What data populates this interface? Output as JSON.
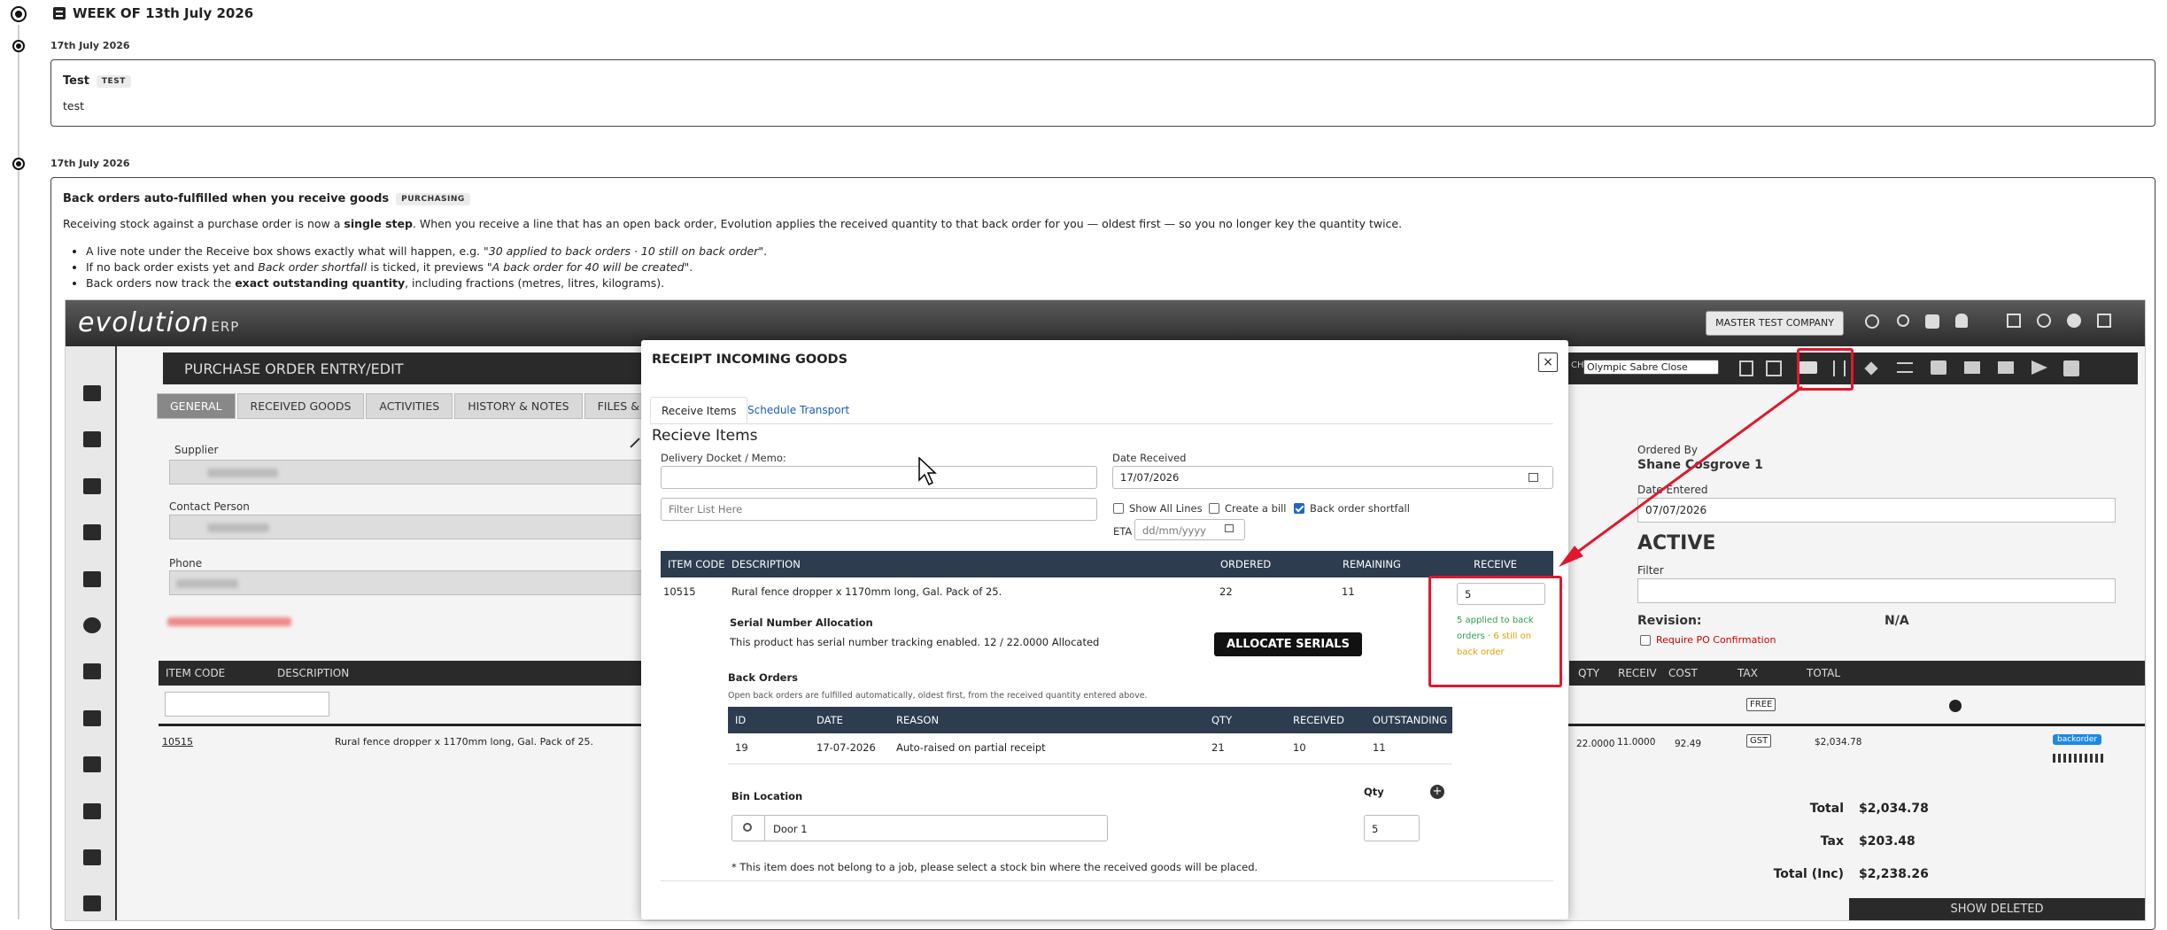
{
  "timeline": {
    "week": "WEEK OF 13th July 2026",
    "entries": [
      {
        "date": "17th July 2026",
        "title": "Test",
        "badge": "TEST",
        "body": "test"
      },
      {
        "date": "17th July 2026",
        "title": "Back orders auto-fulfilled when you receive goods",
        "badge": "PURCHASING",
        "intro_1": "Receiving stock against a purchase order is now a ",
        "intro_bold": "single step",
        "intro_2": ". When you receive a line that has an open back order, Evolution applies the received quantity to that back order for you — oldest first — so you no longer key the quantity twice.",
        "bullets": [
          {
            "a": "A live note under the Receive box shows exactly what will happen, e.g. ",
            "i": "\"30 applied to back orders · 10 still on back order\"",
            "b": "."
          },
          {
            "a": "If no back order exists yet and ",
            "i": "Back order shortfall",
            "b": " is ticked, it previews ",
            "i2": "\"A back order for 40 will be created\"",
            "c": "."
          },
          {
            "a": "Back orders now track the ",
            "bold": "exact outstanding quantity",
            "b": ", including fractions (metres, litres, kilograms)."
          }
        ]
      }
    ]
  },
  "erp": {
    "logo": "evolution",
    "logo_suffix": "ERP",
    "company": "MASTER TEST COMPANY",
    "branch_select": "Olympic Sabre Close",
    "page_title": "PURCHASE ORDER ENTRY/EDIT",
    "tabs": [
      "GENERAL",
      "RECEIVED GOODS",
      "ACTIVITIES",
      "HISTORY & NOTES",
      "FILES &"
    ],
    "supplier_label": "Supplier",
    "contact_label": "Contact Person",
    "phone_label": "Phone",
    "ordered_by_label": "Ordered By",
    "ordered_by": "Shane Cosgrove 1",
    "date_entered_label": "Date Entered",
    "date_entered": "07/07/2026",
    "status": "ACTIVE",
    "filter_label": "Filter",
    "revision_label": "Revision:",
    "revision": "N/A",
    "require_po": "Require PO Confirmation",
    "grid_headers_left": [
      "ITEM CODE",
      "DESCRIPTION"
    ],
    "grid_headers_right": [
      "QTY",
      "RECEIV",
      "COST",
      "TAX",
      "TOTAL"
    ],
    "row": {
      "code": "10515",
      "desc": "Rural fence dropper x 1170mm long, Gal. Pack of 25.",
      "qty": "22.0000",
      "recv": "11.0000",
      "cost": "92.49",
      "tax": "GST",
      "total": "$2,034.78",
      "tag": "backorder"
    },
    "filter_tax": "FREE",
    "totals": [
      {
        "label": "Total",
        "value": "$2,034.78"
      },
      {
        "label": "Tax",
        "value": "$203.48"
      },
      {
        "label": "Total (Inc)",
        "value": "$2,238.26"
      }
    ],
    "show_deleted": "SHOW DELETED"
  },
  "modal": {
    "title": "RECEIPT INCOMING GOODS",
    "close": "×",
    "tabs": [
      "Receive Items",
      "Schedule Transport"
    ],
    "heading": "Recieve Items",
    "docket_label": "Delivery Docket / Memo:",
    "date_label": "Date Received",
    "date_value": "17/07/2026",
    "filter_placeholder": "Filter List Here",
    "show_all": "Show All Lines",
    "create_bill": "Create a bill",
    "back_order": "Back order shortfall",
    "eta_label": "ETA",
    "eta_placeholder": "dd/mm/yyyy",
    "table_headers": [
      "ITEM CODE",
      "DESCRIPTION",
      "ORDERED",
      "REMAINING",
      "RECEIVE"
    ],
    "item": {
      "code": "10515",
      "desc": "Rural fence dropper x 1170mm long, Gal. Pack of 25.",
      "ordered": "22",
      "remaining": "11",
      "receive": "5"
    },
    "note_green": "5 applied to back orders",
    "note_sep": " · ",
    "note_orange": "6 still on back order",
    "serial_title": "Serial Number Allocation",
    "serial_text": "This product has serial number tracking enabled. 12 / 22.0000 Allocated",
    "allocate": "ALLOCATE SERIALS",
    "bo_title": "Back Orders",
    "bo_sub": "Open back orders are fulfilled automatically, oldest first, from the received quantity entered above.",
    "bo_headers": [
      "ID",
      "DATE",
      "REASON",
      "QTY",
      "RECEIVED",
      "OUTSTANDING"
    ],
    "bo_row": {
      "id": "19",
      "date": "17-07-2026",
      "reason": "Auto-raised on partial receipt",
      "qty": "21",
      "received": "10",
      "outstanding": "11"
    },
    "bin_label": "Bin Location",
    "qty_label": "Qty",
    "bin_value": "Door 1",
    "bin_qty": "5",
    "footnote": "* This item does not belong to a job, please select a stock bin where the received goods will be placed."
  },
  "colors": {
    "highlight": "#e0182e",
    "table_header": "#2d3c4f",
    "note_green": "#2e9e4f",
    "note_orange": "#e0a000"
  }
}
